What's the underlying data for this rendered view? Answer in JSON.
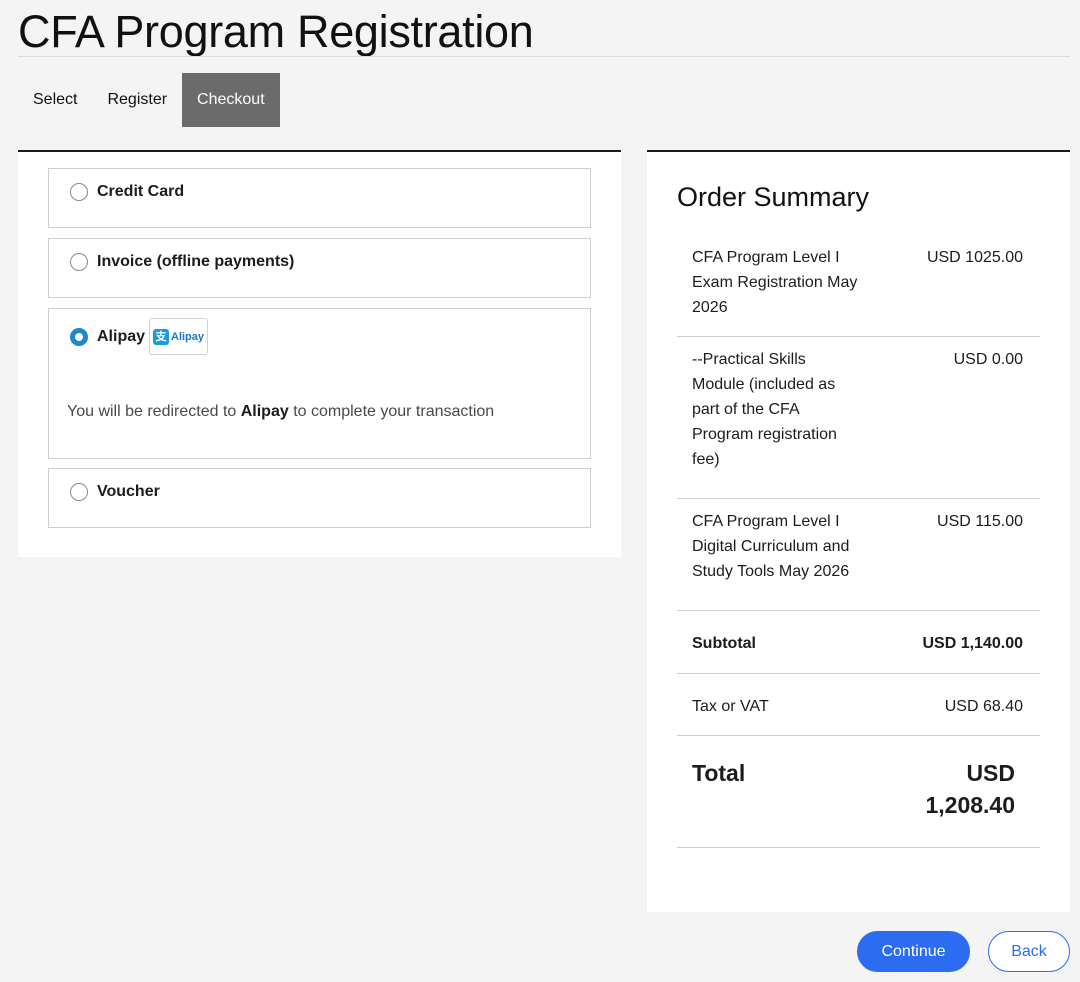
{
  "page": {
    "title": "CFA Program Registration"
  },
  "steps": [
    {
      "label": "Select"
    },
    {
      "label": "Register"
    },
    {
      "label": "Checkout"
    }
  ],
  "payment": {
    "options": [
      {
        "label": "Credit Card",
        "selected": false
      },
      {
        "label": "Invoice (offline payments)",
        "selected": false
      },
      {
        "label": "Alipay",
        "selected": true,
        "logo_text": "Alipay"
      },
      {
        "label": "Voucher",
        "selected": false
      }
    ],
    "redirect": {
      "prefix": "You will be redirected to ",
      "provider": "Alipay",
      "suffix": " to complete your transaction"
    }
  },
  "summary": {
    "title": "Order Summary",
    "items": [
      {
        "desc": "CFA Program Level I Exam Registration May 2026",
        "amount": "USD 1025.00"
      },
      {
        "desc": "--Practical Skills Module (included as part of the CFA Program registration fee)",
        "amount": "USD 0.00"
      },
      {
        "desc": "CFA Program Level I Digital Curriculum and Study Tools May 2026",
        "amount": "USD 115.00"
      },
      {
        "desc": "Subtotal",
        "amount": "USD 1,140.00"
      },
      {
        "desc": "Tax or VAT",
        "amount": "USD 68.40"
      },
      {
        "desc": "Total",
        "amount": "USD 1,208.40"
      }
    ]
  },
  "actions": {
    "continue_label": "Continue",
    "back_label": "Back"
  },
  "colors": {
    "accent": "#2c6cf0",
    "radio": "#1f86c9",
    "active_step": "#6b6b6b"
  }
}
